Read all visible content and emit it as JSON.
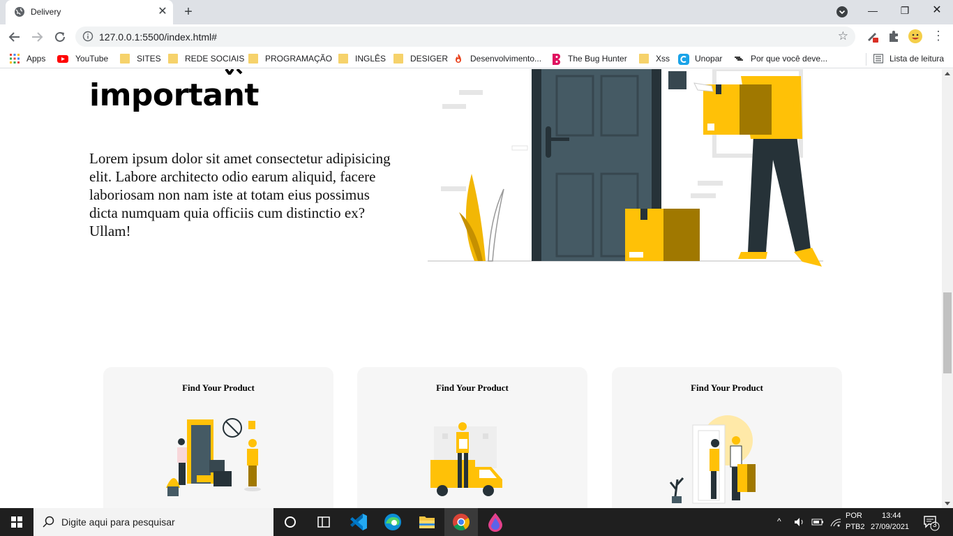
{
  "browser": {
    "tab": {
      "title": "Delivery",
      "favicon": "globe-icon"
    },
    "url": "127.0.0.1:5500/index.html#",
    "bookmarks": [
      {
        "label": "Apps",
        "icon": "apps-grid-icon"
      },
      {
        "label": "YouTube",
        "icon": "youtube-icon"
      },
      {
        "label": "SITES",
        "icon": "folder-icon"
      },
      {
        "label": "REDE SOCIAIS",
        "icon": "folder-icon"
      },
      {
        "label": "PROGRAMAÇÃO",
        "icon": "folder-icon"
      },
      {
        "label": "INGLÊS",
        "icon": "folder-icon"
      },
      {
        "label": "DESIGER",
        "icon": "folder-icon"
      },
      {
        "label": "Desenvolvimento...",
        "icon": "flame-icon"
      },
      {
        "label": "The Bug Hunter",
        "icon": "bug-hunter-icon"
      },
      {
        "label": "Xss",
        "icon": "folder-icon"
      },
      {
        "label": "Unopar",
        "icon": "unopar-icon"
      },
      {
        "label": "Por que você deve...",
        "icon": "link-icon"
      }
    ],
    "reading_list": "Lista de leitura"
  },
  "page": {
    "hero": {
      "title": "important",
      "text": "Lorem ipsum dolor sit amet consectetur adipisicing elit. Labore architecto odio earum aliquid, facere laboriosam non nam iste at totam eius possimus dicta numquam quia officiis cum distinctio ex? Ullam!"
    },
    "cards": [
      {
        "title": "Find Your Product"
      },
      {
        "title": "Find Your Product"
      },
      {
        "title": "Find Your Product"
      }
    ],
    "accent_color": "#ffc107"
  },
  "taskbar": {
    "search_placeholder": "Digite aqui para pesquisar",
    "language": "POR",
    "layout": "PTB2",
    "time": "13:44",
    "date": "27/09/2021",
    "notifications": "3"
  }
}
